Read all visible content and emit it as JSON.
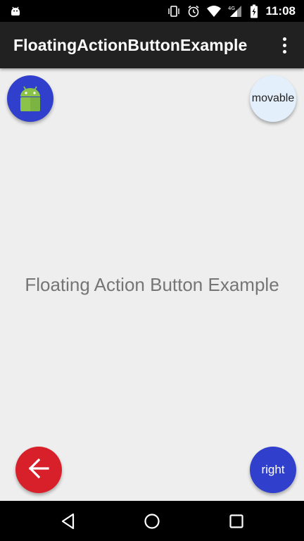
{
  "status_bar": {
    "time": "11:08",
    "network_label": "4G",
    "icons": [
      "android-debug-icon",
      "vibrate-icon",
      "alarm-icon",
      "wifi-icon",
      "cell-signal-icon",
      "battery-charging-icon"
    ]
  },
  "app_bar": {
    "title": "FloatingActionButtonExample",
    "overflow_icon": "more-vert-icon"
  },
  "content": {
    "center_text": "Floating Action Button Example"
  },
  "fabs": {
    "top_left_icon": "android-icon",
    "movable_label": "movable",
    "back_icon": "arrow-back-icon",
    "right_label": "right"
  },
  "nav_bar": {
    "icons": [
      "back-triangle-icon",
      "home-circle-icon",
      "recents-square-icon"
    ]
  },
  "colors": {
    "app_bar": "#212121",
    "background": "#eeeeee",
    "fab_blue": "#3040cc",
    "fab_red": "#d8202a",
    "fab_light": "#e3f0fb",
    "android_green": "#8bc34a",
    "center_text": "#757575"
  }
}
